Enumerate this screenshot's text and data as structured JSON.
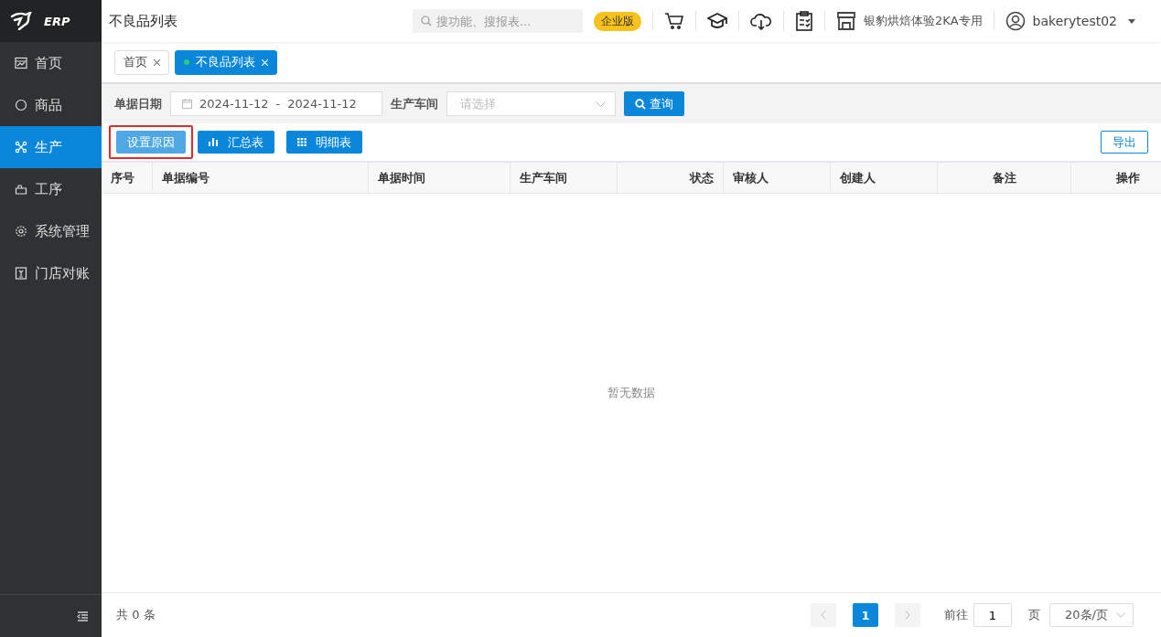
{
  "sidebar": {
    "logo": "ERP",
    "items": [
      {
        "label": "首页",
        "selected": false
      },
      {
        "label": "商品",
        "selected": false
      },
      {
        "label": "生产",
        "selected": true
      },
      {
        "label": "工序",
        "selected": false
      },
      {
        "label": "系统管理",
        "selected": false
      },
      {
        "label": "门店对账",
        "selected": false
      }
    ]
  },
  "header": {
    "title": "不良品列表",
    "search": {
      "placeholder": "搜功能、搜报表..."
    },
    "edition_badge": "企业版",
    "store": "银豹烘焙体验2KA专用",
    "user": "bakerytest02"
  },
  "tabs": [
    {
      "label": "首页",
      "selected": false
    },
    {
      "label": "不良品列表",
      "selected": true
    }
  ],
  "filters": {
    "date_label": "单据日期",
    "date_start": "2024-11-12",
    "date_separator": "-",
    "date_end": "2024-11-12",
    "workshop_label": "生产车间",
    "workshop_placeholder": "请选择",
    "query_button": "查询"
  },
  "toolbar": {
    "buttons": [
      {
        "label": "设置原因",
        "kind": "light",
        "highlighted": true
      },
      {
        "label": "汇总表",
        "kind": "bars",
        "highlighted": false
      },
      {
        "label": "明细表",
        "kind": "grid",
        "highlighted": false
      }
    ],
    "export_button": "导出"
  },
  "table": {
    "columns": [
      {
        "label": "序号"
      },
      {
        "label": "单据编号"
      },
      {
        "label": "单据时间"
      },
      {
        "label": "生产车间"
      },
      {
        "label": "状态"
      },
      {
        "label": "审核人"
      },
      {
        "label": "创建人"
      },
      {
        "label": "备注"
      },
      {
        "label": "操作"
      }
    ],
    "empty_text": "暂无数据"
  },
  "footer": {
    "total": "共 0 条",
    "pages": [
      {
        "label": "1",
        "selected": true
      }
    ],
    "goto_label": "前往",
    "goto_value": "1",
    "page_unit": "页",
    "page_size": "20条/页"
  }
}
